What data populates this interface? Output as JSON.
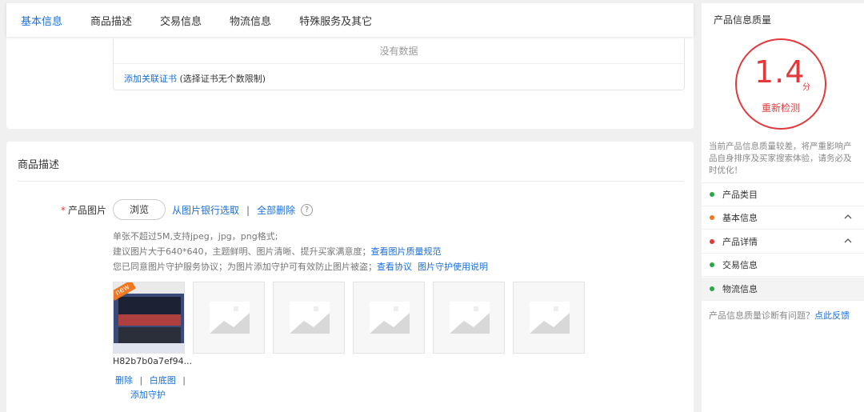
{
  "tabs": [
    {
      "label": "基本信息",
      "active": true
    },
    {
      "label": "商品描述",
      "active": false
    },
    {
      "label": "交易信息",
      "active": false
    },
    {
      "label": "物流信息",
      "active": false
    },
    {
      "label": "特殊服务及其它",
      "active": false
    }
  ],
  "certificate": {
    "empty_text": "没有数据",
    "add_link": "添加关联证书",
    "add_note": "(选择证书无个数限制)"
  },
  "description": {
    "title": "商品描述",
    "product_image": {
      "required_mark": "*",
      "label": "产品图片",
      "browse_button": "浏览",
      "from_bank_link": "从图片银行选取",
      "separator": "|",
      "delete_all_link": "全部删除",
      "help_icon": "?",
      "hint_1": "单张不超过5M,支持jpeg，jpg，png格式;",
      "hint_2_text": "建议图片大于640*640，主题鲜明、图片清晰、提升买家满意度；",
      "hint_2_link": "查看图片质量规范",
      "hint_3_text": "您已同意图片守护服务协议；为图片添加守护可有效防止图片被盗；",
      "hint_3_link_1": "查看协议",
      "hint_3_link_2": "图片守护使用说明",
      "badge": "new",
      "filename": "H82b7b0a7ef94...",
      "delete_link": "删除",
      "white_bg_link": "白底图",
      "add_protect_link": "添加守护"
    }
  },
  "quality": {
    "title": "产品信息质量",
    "score": "1.4",
    "score_unit": "分",
    "recheck": "重新检测",
    "note": "当前产品信息质量较差，将严重影响产品自身排序及买家搜索体验，请务必及时优化！",
    "categories": [
      {
        "label": "产品类目",
        "color": "#2aa745",
        "expandable": false
      },
      {
        "label": "基本信息",
        "color": "#f07820",
        "expandable": true
      },
      {
        "label": "产品详情",
        "color": "#e4393c",
        "expandable": true
      },
      {
        "label": "交易信息",
        "color": "#2aa745",
        "expandable": false
      },
      {
        "label": "物流信息",
        "color": "#2aa745",
        "expandable": false,
        "highlight": true
      }
    ],
    "feedback_text": "产品信息质量诊断有问题？",
    "feedback_link": "点此反馈"
  },
  "colors": {
    "accent": "#1a6fd8",
    "danger": "#e4393c"
  }
}
